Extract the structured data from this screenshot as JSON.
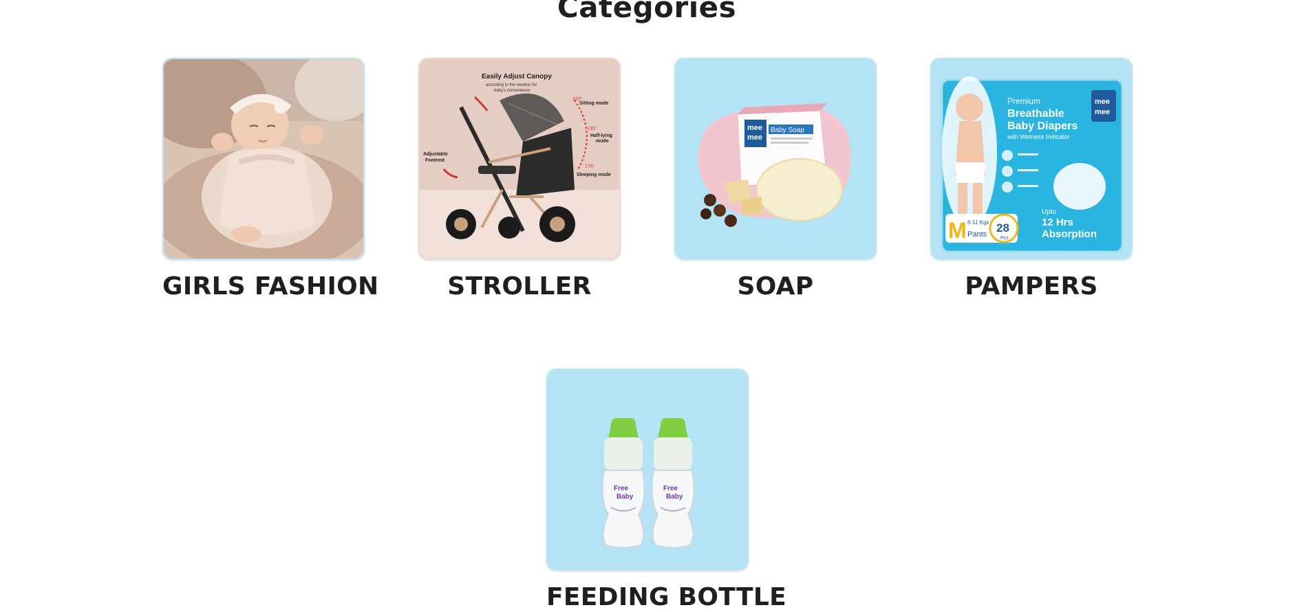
{
  "page": {
    "title": "Categories"
  },
  "colors": {
    "card_bg": "#b3e3f4",
    "heading": "#1f1f1f"
  },
  "categories": [
    {
      "label": "GIRLS FASHION",
      "image": "baby-girl-in-dress-image"
    },
    {
      "label": "STROLLER",
      "image": "stroller-image",
      "image_text": {
        "headline": "Easily Adjust Canopy",
        "sub1": "according to the weather for",
        "sub2": "baby's convenience",
        "angle1": "160°",
        "mode1": "Sitting mode",
        "angle2": "135°",
        "mode2a": "Half-lying",
        "mode2b": "mode",
        "angle3": "175°",
        "mode3": "Sleeping mode",
        "foot1": "Adjustable",
        "foot2": "Footrest"
      }
    },
    {
      "label": "SOAP",
      "image": "baby-soap-image",
      "image_text": {
        "brand1": "mee",
        "brand2": "mee",
        "product": "Baby Soap"
      }
    },
    {
      "label": "PAMPERS",
      "image": "baby-diapers-pack-image",
      "image_text": {
        "premium": "Premium",
        "line1": "Breathable",
        "line2": "Baby Diapers",
        "line3": "with Wetness Indicator",
        "brand1": "mee",
        "brand2": "mee",
        "size": "M",
        "kgs": "6-11 Kgs",
        "pants": "Pants",
        "count": "28",
        "pcs": "Pcs",
        "upto": "Upto",
        "hrs": "12 Hrs",
        "absorption": "Absorption"
      }
    },
    {
      "label": "FEEDING BOTTLE",
      "image": "feeding-bottles-image",
      "image_text": {
        "brand1": "Free",
        "brand2": "Baby"
      }
    }
  ]
}
